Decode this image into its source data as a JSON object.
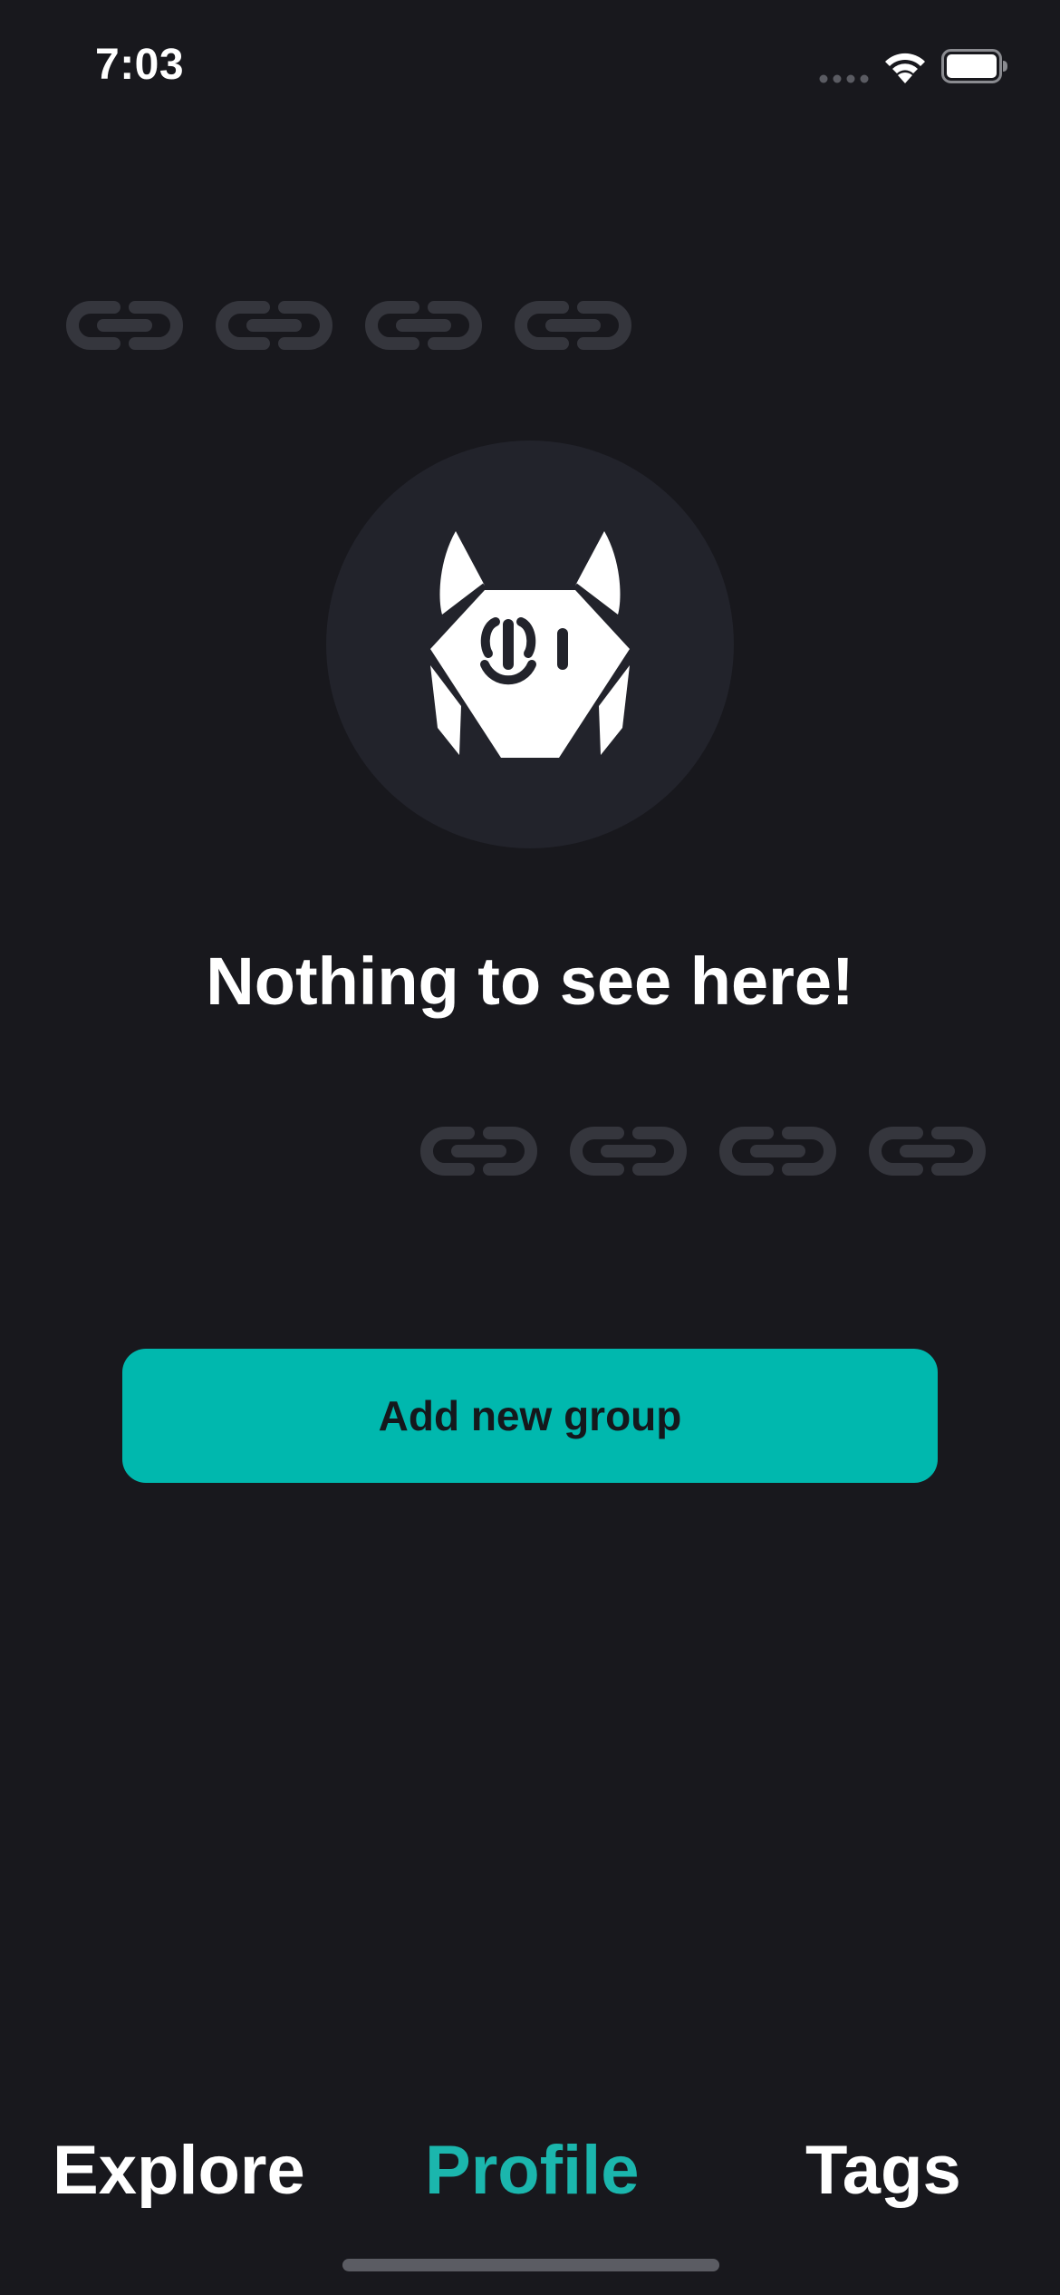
{
  "status_bar": {
    "time": "7:03"
  },
  "icons": {
    "link": "link-icon",
    "wolf": "wolf-logo-icon",
    "wifi": "wifi-icon",
    "battery": "battery-icon",
    "signal": "cellular-signal-icon"
  },
  "empty_state": {
    "title": "Nothing to see here!",
    "button_label": "Add new group"
  },
  "tabs": [
    {
      "label": "Explore",
      "active": false
    },
    {
      "label": "Profile",
      "active": true
    },
    {
      "label": "Tags",
      "active": false
    }
  ],
  "colors": {
    "background": "#18181d",
    "accent": "#00b8ae",
    "avatar_bg": "#22232b",
    "link_decor": "#35363d"
  }
}
